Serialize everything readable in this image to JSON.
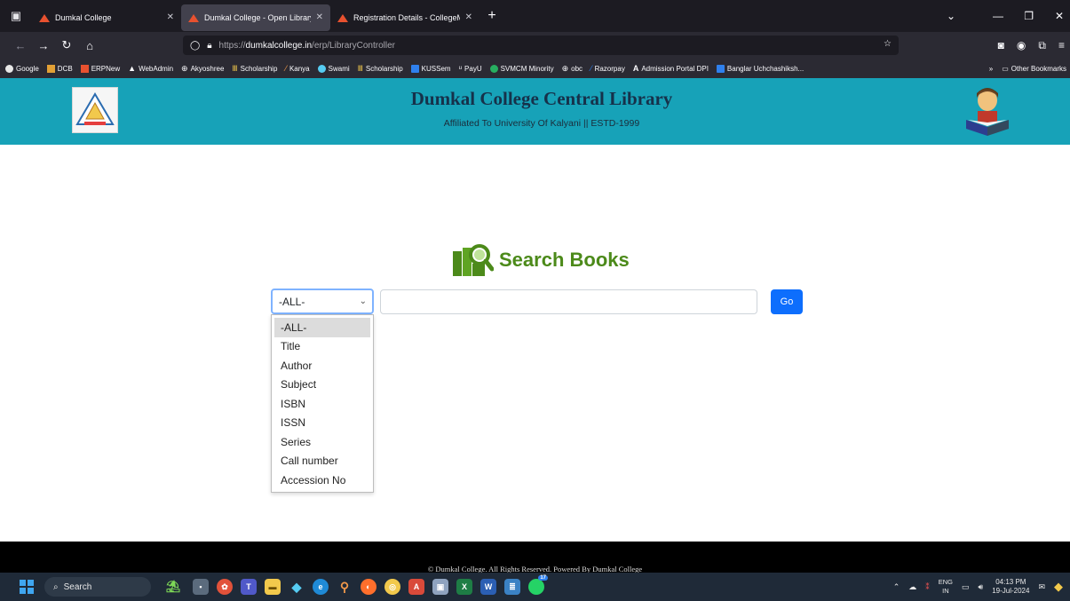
{
  "browser": {
    "tabs": [
      {
        "title": "Dumkal College",
        "active": false
      },
      {
        "title": "Dumkal College - Open Library",
        "active": true
      },
      {
        "title": "Registration Details - CollegeM",
        "active": false
      }
    ],
    "url": {
      "protocol": "https://",
      "host": "dumkalcollege.in",
      "path": "/erp/LibraryController"
    },
    "bookmarks": [
      "Google",
      "DCB",
      "ERPNew",
      "WebAdmin",
      "Akyoshree",
      "Scholarship",
      "Kanya",
      "Swami",
      "Scholarship",
      "KUSSem",
      "PayU",
      "SVMCM Minority",
      "obc",
      "Razorpay",
      "Admission Portal DPI",
      "Banglar Uchchashiksh..."
    ],
    "other_bookmarks": "Other Bookmarks"
  },
  "header": {
    "title": "Dumkal College Central Library",
    "subtitle": "Affiliated To University Of Kalyani || ESTD-1999",
    "logo_text": "ESTD-1999"
  },
  "search": {
    "heading": "Search Books",
    "selected_field": "-ALL-",
    "input_value": "",
    "go_label": "Go",
    "options": [
      "-ALL-",
      "Title",
      "Author",
      "Subject",
      "ISBN",
      "ISSN",
      "Series",
      "Call number",
      "Accession No"
    ]
  },
  "footer": {
    "text": "© Dumkal College. All Rights Reserved. Powered By Dumkal College"
  },
  "taskbar": {
    "search_label": "Search",
    "lang_top": "ENG",
    "lang_bottom": "IN",
    "time": "04:13 PM",
    "date": "19-Jul-2024",
    "chat_badge": "17"
  },
  "colors": {
    "header_bg": "#17a2b8",
    "heading_green": "#4c8a1a",
    "go_blue": "#0d6efd"
  }
}
